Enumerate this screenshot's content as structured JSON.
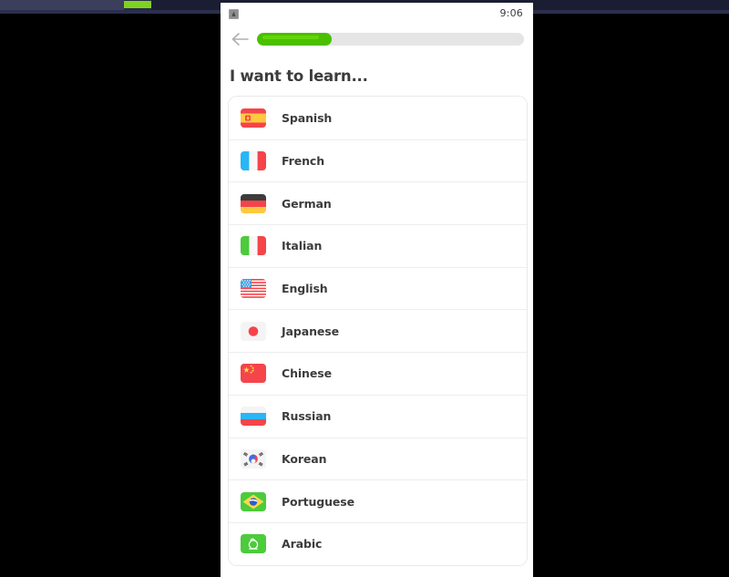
{
  "desktop": {
    "background_color": "#000000",
    "os_bar_color": "#272b45",
    "os_bar_accent_color": "#7ed321"
  },
  "phone": {
    "status_bar": {
      "icon": "app-notification-icon",
      "time": "9:06"
    },
    "nav": {
      "back_icon": "back-arrow-icon",
      "progress_percent": 28,
      "progress_fill_color": "#4ac000",
      "progress_track_color": "#e5e5e5"
    },
    "heading": "I want to learn...",
    "languages": [
      {
        "name": "Spanish",
        "flag": "flag-spain-icon"
      },
      {
        "name": "French",
        "flag": "flag-france-icon"
      },
      {
        "name": "German",
        "flag": "flag-germany-icon"
      },
      {
        "name": "Italian",
        "flag": "flag-italy-icon"
      },
      {
        "name": "English",
        "flag": "flag-usa-icon"
      },
      {
        "name": "Japanese",
        "flag": "flag-japan-icon"
      },
      {
        "name": "Chinese",
        "flag": "flag-china-icon"
      },
      {
        "name": "Russian",
        "flag": "flag-russia-icon"
      },
      {
        "name": "Korean",
        "flag": "flag-south-korea-icon"
      },
      {
        "name": "Portuguese",
        "flag": "flag-brazil-icon"
      },
      {
        "name": "Arabic",
        "flag": "flag-saudi-arabia-icon"
      }
    ]
  }
}
